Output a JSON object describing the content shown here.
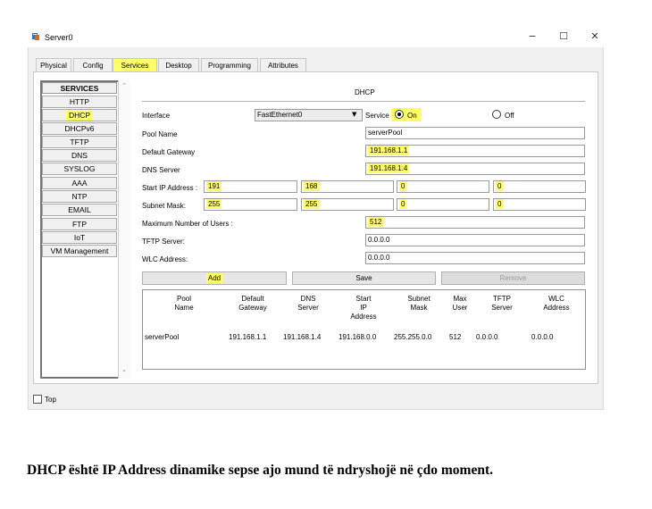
{
  "window": {
    "title": "Server0",
    "icon": "server-icon",
    "controls": [
      "−",
      "☐",
      "✕"
    ]
  },
  "tabs": [
    {
      "label": "Physical",
      "active": false
    },
    {
      "label": "Config",
      "active": false
    },
    {
      "label": "Services",
      "active": true
    },
    {
      "label": "Desktop",
      "active": false
    },
    {
      "label": "Programming",
      "active": false
    },
    {
      "label": "Attributes",
      "active": false
    }
  ],
  "services": {
    "header": "SERVICES",
    "items": [
      "HTTP",
      "DHCP",
      "DHCPv6",
      "TFTP",
      "DNS",
      "SYSLOG",
      "AAA",
      "NTP",
      "EMAIL",
      "FTP",
      "IoT",
      "VM Management"
    ],
    "selected": "DHCP"
  },
  "dhcp": {
    "section_title": "DHCP",
    "interface_label": "Interface",
    "interface_value": "FastEthernet0",
    "service_label": "Service",
    "on_label": "On",
    "off_label": "Off",
    "service_state": "On",
    "pool_name_label": "Pool Name",
    "pool_name_value": "serverPool",
    "default_gateway_label": "Default Gateway",
    "default_gateway_value": "191.168.1.1",
    "dns_server_label": "DNS Server",
    "dns_server_value": "191.168.1.4",
    "start_ip_label": "Start IP Address :",
    "start_ip": [
      "191",
      "168",
      "0",
      "0"
    ],
    "subnet_mask_label": "Subnet Mask:",
    "subnet_mask": [
      "255",
      "255",
      "0",
      "0"
    ],
    "max_users_label": "Maximum Number of Users :",
    "max_users_value": "512",
    "tftp_label": "TFTP Server:",
    "tftp_value": "0.0.0.0",
    "wlc_label": "WLC Address:",
    "wlc_value": "0.0.0.0",
    "add_label": "Add",
    "save_label": "Save",
    "remove_label": "Remove"
  },
  "pool_table": {
    "headers": [
      "Pool\nName",
      "Default\nGateway",
      "DNS\nServer",
      "Start\nIP\nAddress",
      "Subnet\nMask",
      "Max\nUser",
      "TFTP\nServer",
      "WLC\nAddress"
    ],
    "rows": [
      [
        "serverPool",
        "191.168.1.1",
        "191.168.1.4",
        "191.168.0.0",
        "255.255.0.0",
        "512",
        "0.0.0.0",
        "0.0.0.0"
      ]
    ]
  },
  "footer": {
    "top_label": "Top",
    "top_checked": false
  },
  "caption": "DHCP është IP Address dinamike sepse ajo mund të ndryshojë në çdo moment.",
  "colors": {
    "highlight": "#ffff66",
    "window_bg": "#f0f0f0"
  }
}
